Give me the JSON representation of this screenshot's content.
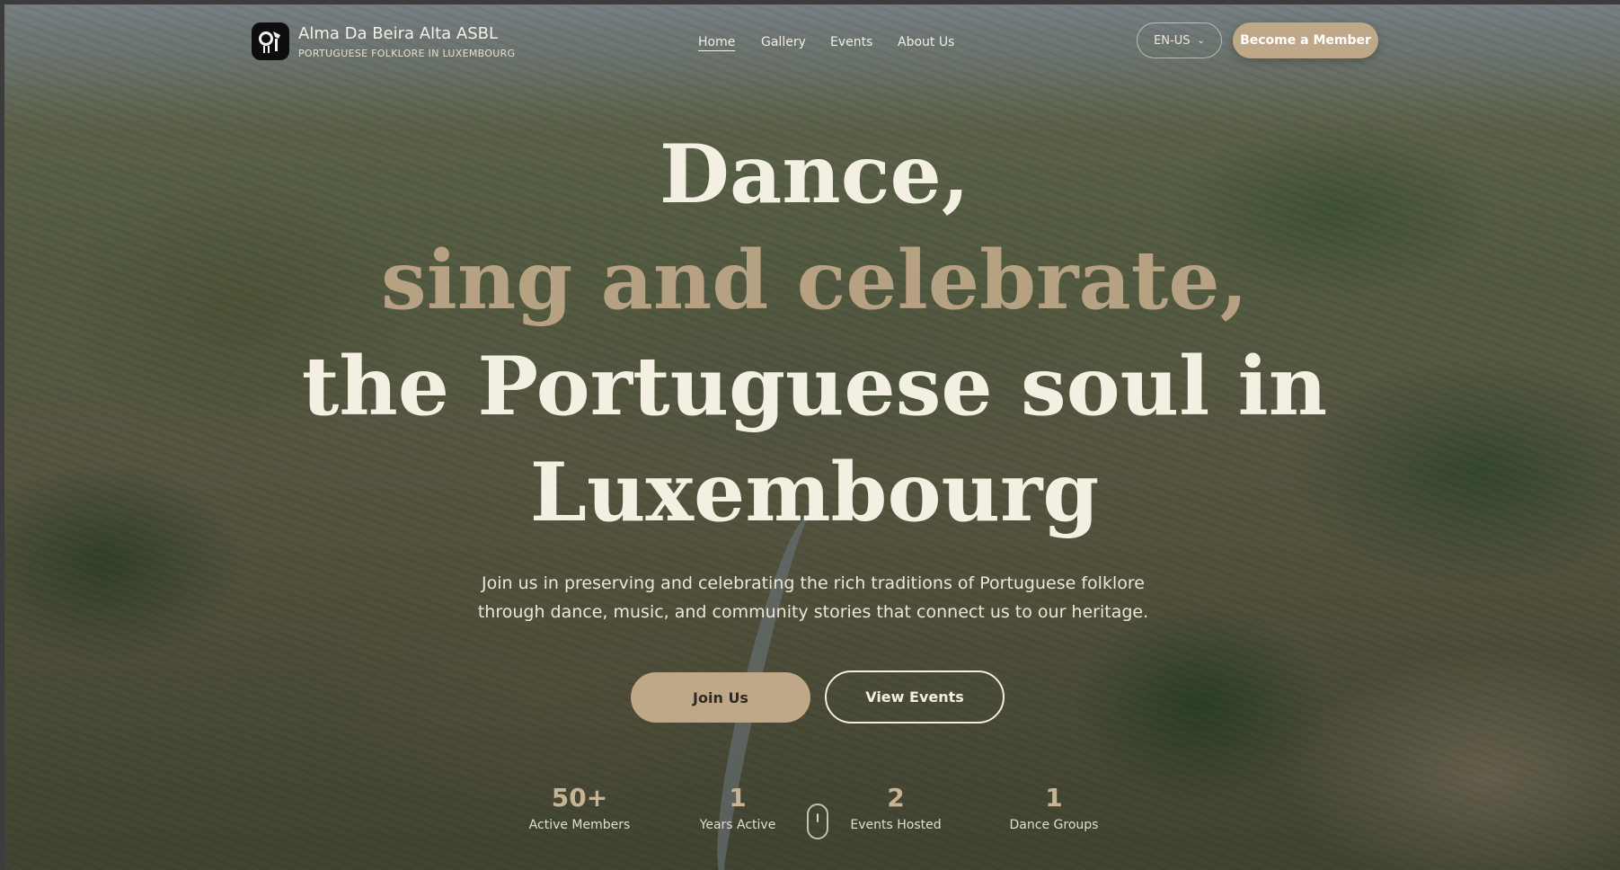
{
  "brand": {
    "title": "Alma Da Beira Alta ASBL",
    "subtitle": "PORTUGUESE FOLKLORE IN LUXEMBOURG"
  },
  "nav": {
    "items": [
      {
        "label": "Home",
        "active": true
      },
      {
        "label": "Gallery",
        "active": false
      },
      {
        "label": "Events",
        "active": false
      },
      {
        "label": "About Us",
        "active": false
      }
    ]
  },
  "language": {
    "value": "EN-US"
  },
  "cta": {
    "member_label": "Become a Member"
  },
  "hero": {
    "line1": "Dance,",
    "line2": "sing and celebrate,",
    "line3": "the Portuguese soul in",
    "line4": "Luxembourg",
    "lead": "Join us in preserving and celebrating the rich traditions of Portuguese folklore through dance, music, and community stories that connect us to our heritage.",
    "join_label": "Join Us",
    "events_label": "View Events"
  },
  "stats": [
    {
      "value": "50+",
      "label": "Active Members"
    },
    {
      "value": "1",
      "label": "Years Active"
    },
    {
      "value": "2",
      "label": "Events Hosted"
    },
    {
      "value": "1",
      "label": "Dance Groups"
    }
  ],
  "colors": {
    "accent": "#bfa888",
    "headline_light": "#f3efe3",
    "headline_accent": "#b6a283"
  }
}
